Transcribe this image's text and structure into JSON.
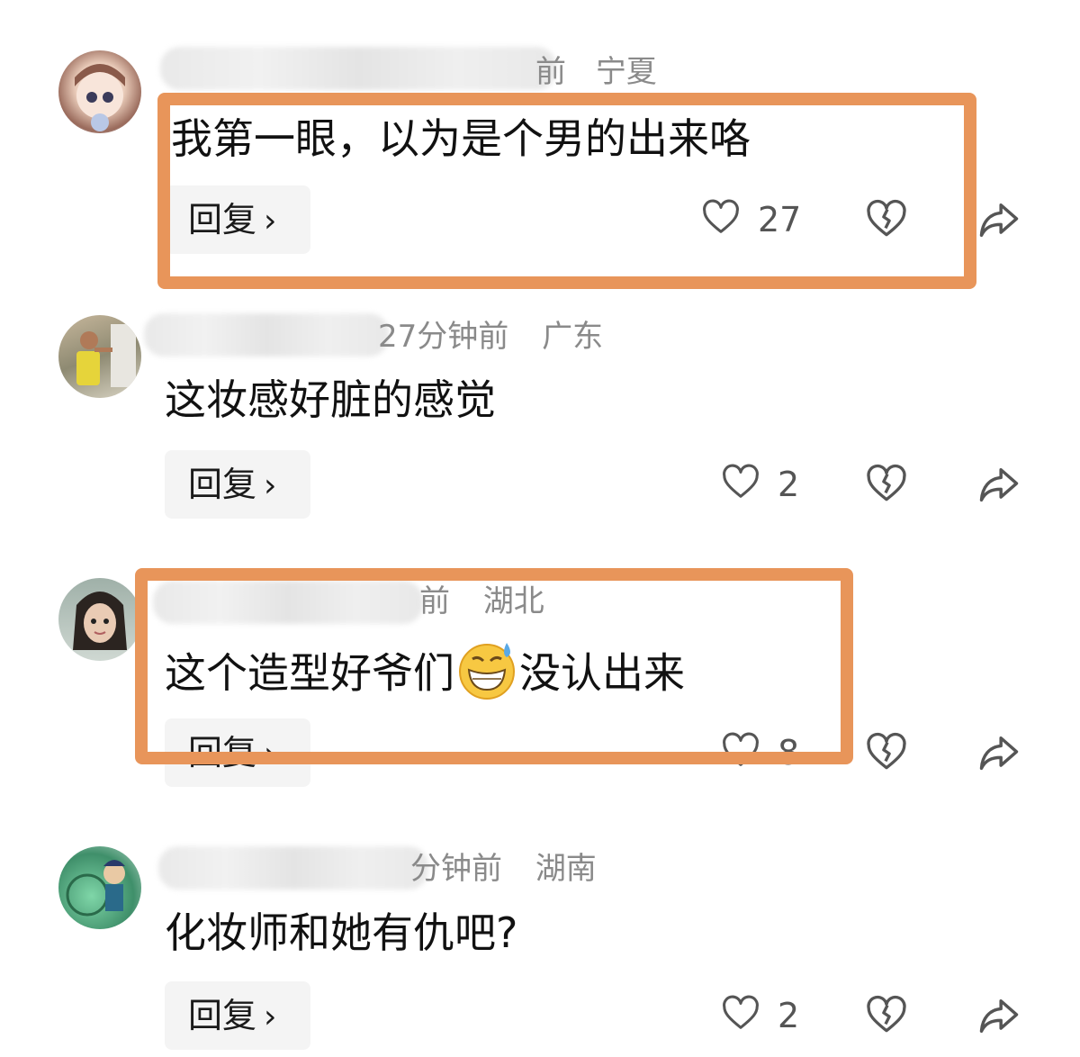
{
  "comments": [
    {
      "meta_suffix": "前",
      "location": "宁夏",
      "text": "我第一眼，以为是个男的出来咯",
      "reply_label": "回复",
      "likes": "27"
    },
    {
      "meta_suffix": "27分钟前",
      "location": "广东",
      "text": "这妆感好脏的感觉",
      "reply_label": "回复",
      "likes": "2"
    },
    {
      "meta_suffix": "前",
      "location": "湖北",
      "text_before_emoji": "这个造型好爷们",
      "emoji": "grinning-sweat-emoji",
      "text_after_emoji": "没认出来",
      "reply_label": "回复",
      "likes": "8"
    },
    {
      "meta_suffix": "分钟前",
      "location": "湖南",
      "text": "化妆师和她有仇吧?",
      "reply_label": "回复",
      "likes": "2"
    }
  ],
  "icons": {
    "like": "heart-outline-icon",
    "dislike": "broken-heart-icon",
    "share": "share-arrow-icon",
    "reply_chevron": "chevron-right-icon"
  },
  "colors": {
    "highlight": "#e8955a",
    "meta": "#8a8a8a",
    "reply_bg": "#f4f4f4"
  }
}
